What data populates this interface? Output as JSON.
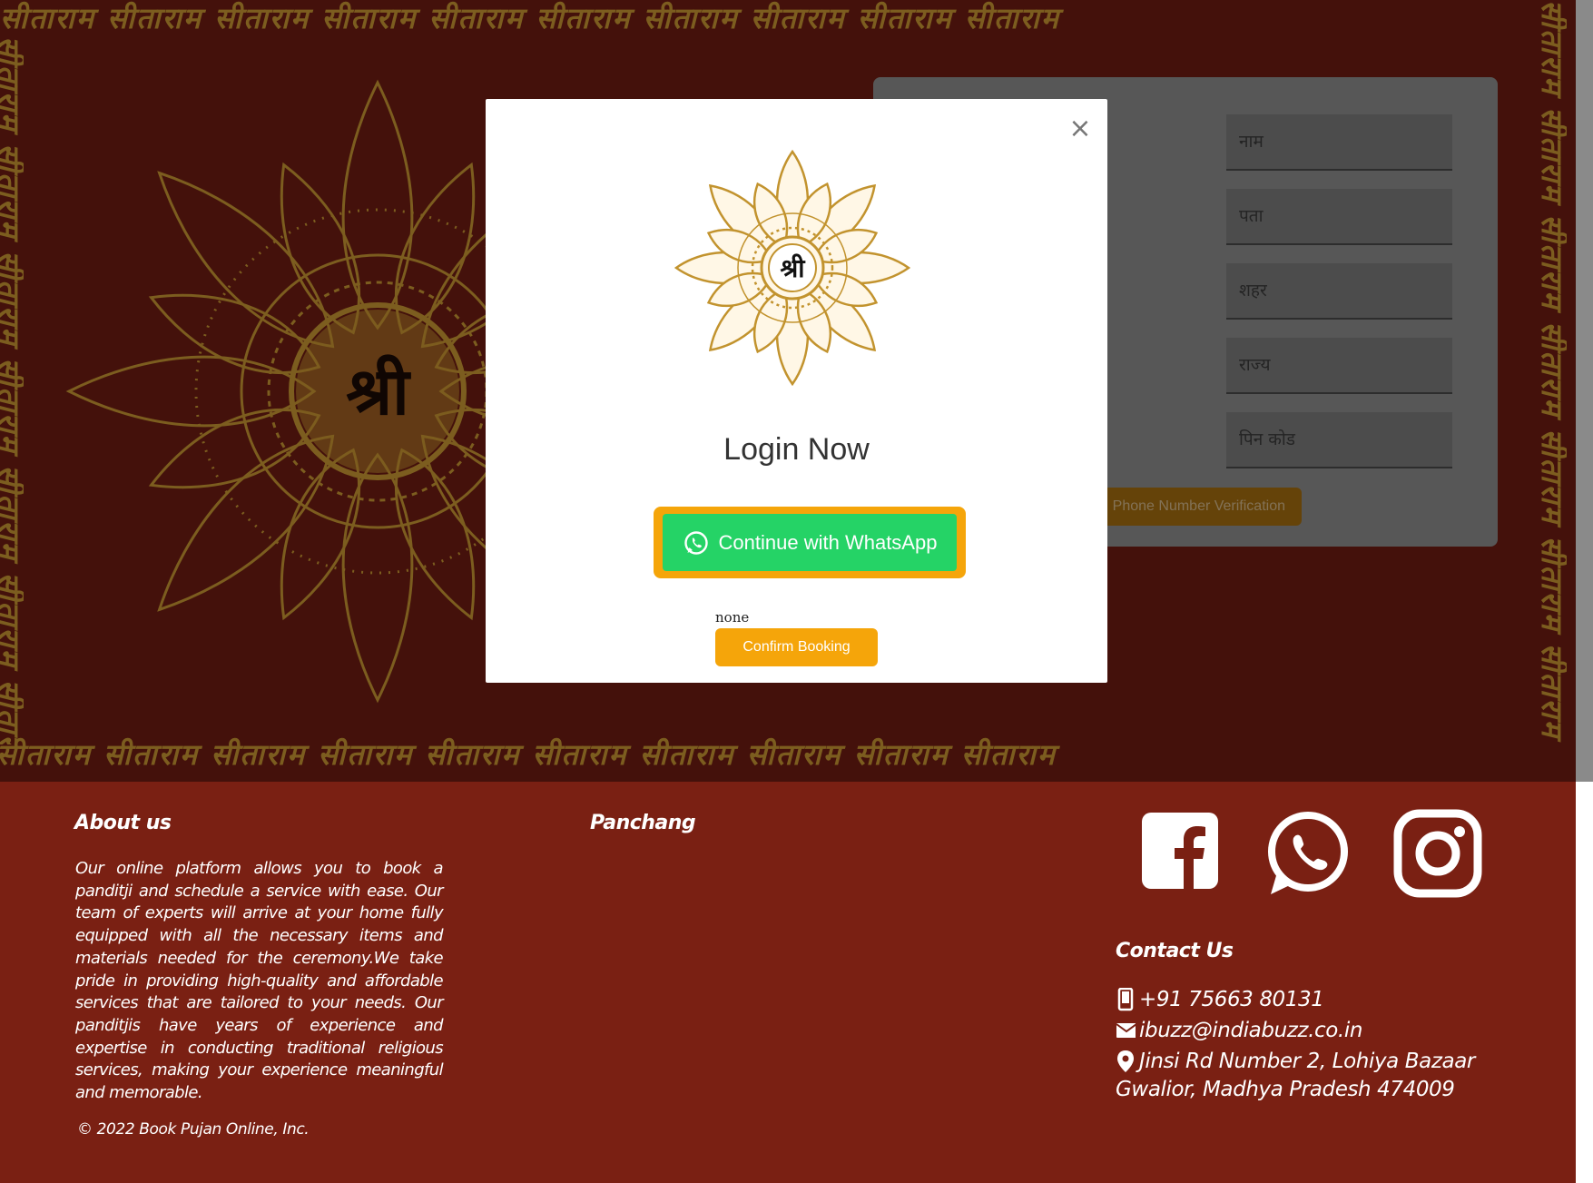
{
  "hero": {
    "border_text": "सीताराम सीताराम सीताराम सीताराम सीताराम सीताराम सीताराम सीताराम सीताराम सीताराम",
    "mandala_glyph": "श्री"
  },
  "form": {
    "fields": [
      {
        "placeholder": "नाम"
      },
      {
        "placeholder": "पता"
      },
      {
        "placeholder": "शहर"
      },
      {
        "placeholder": "राज्य"
      },
      {
        "placeholder": "पिन कोड"
      }
    ],
    "verify_label": "Phone Number Verification"
  },
  "modal": {
    "close_label": "×",
    "logo_glyph": "श्री",
    "title": "Login Now",
    "whatsapp_label": "Continue with WhatsApp",
    "status_text": "none",
    "confirm_label": "Confirm Booking"
  },
  "footer": {
    "about_heading": "About us",
    "about_text": "Our online platform allows you to book a panditji and schedule a service with ease. Our team of experts will arrive at your home fully equipped with all the necessary items and materials needed for the ceremony.We take pride in providing high-quality and affordable services that are tailored to your needs. Our panditjis have years of experience and expertise in conducting traditional religious services, making your experience meaningful and memorable.",
    "panchang_heading": "Panchang",
    "contact_heading": "Contact Us",
    "phone": "+91 75663 80131",
    "email": "ibuzz@indiabuzz.co.in",
    "address_line1": "Jinsi Rd Number 2, Lohiya Bazaar",
    "address_line2": "Gwalior, Madhya Pradesh 474009",
    "copyright": "© 2022 Book Pujan Online, Inc."
  },
  "colors": {
    "hero_bg": "#6e1c12",
    "footer_bg": "#7a2013",
    "gold": "#c89632",
    "orange": "#f5a50a",
    "whatsapp_green": "#25d366"
  }
}
